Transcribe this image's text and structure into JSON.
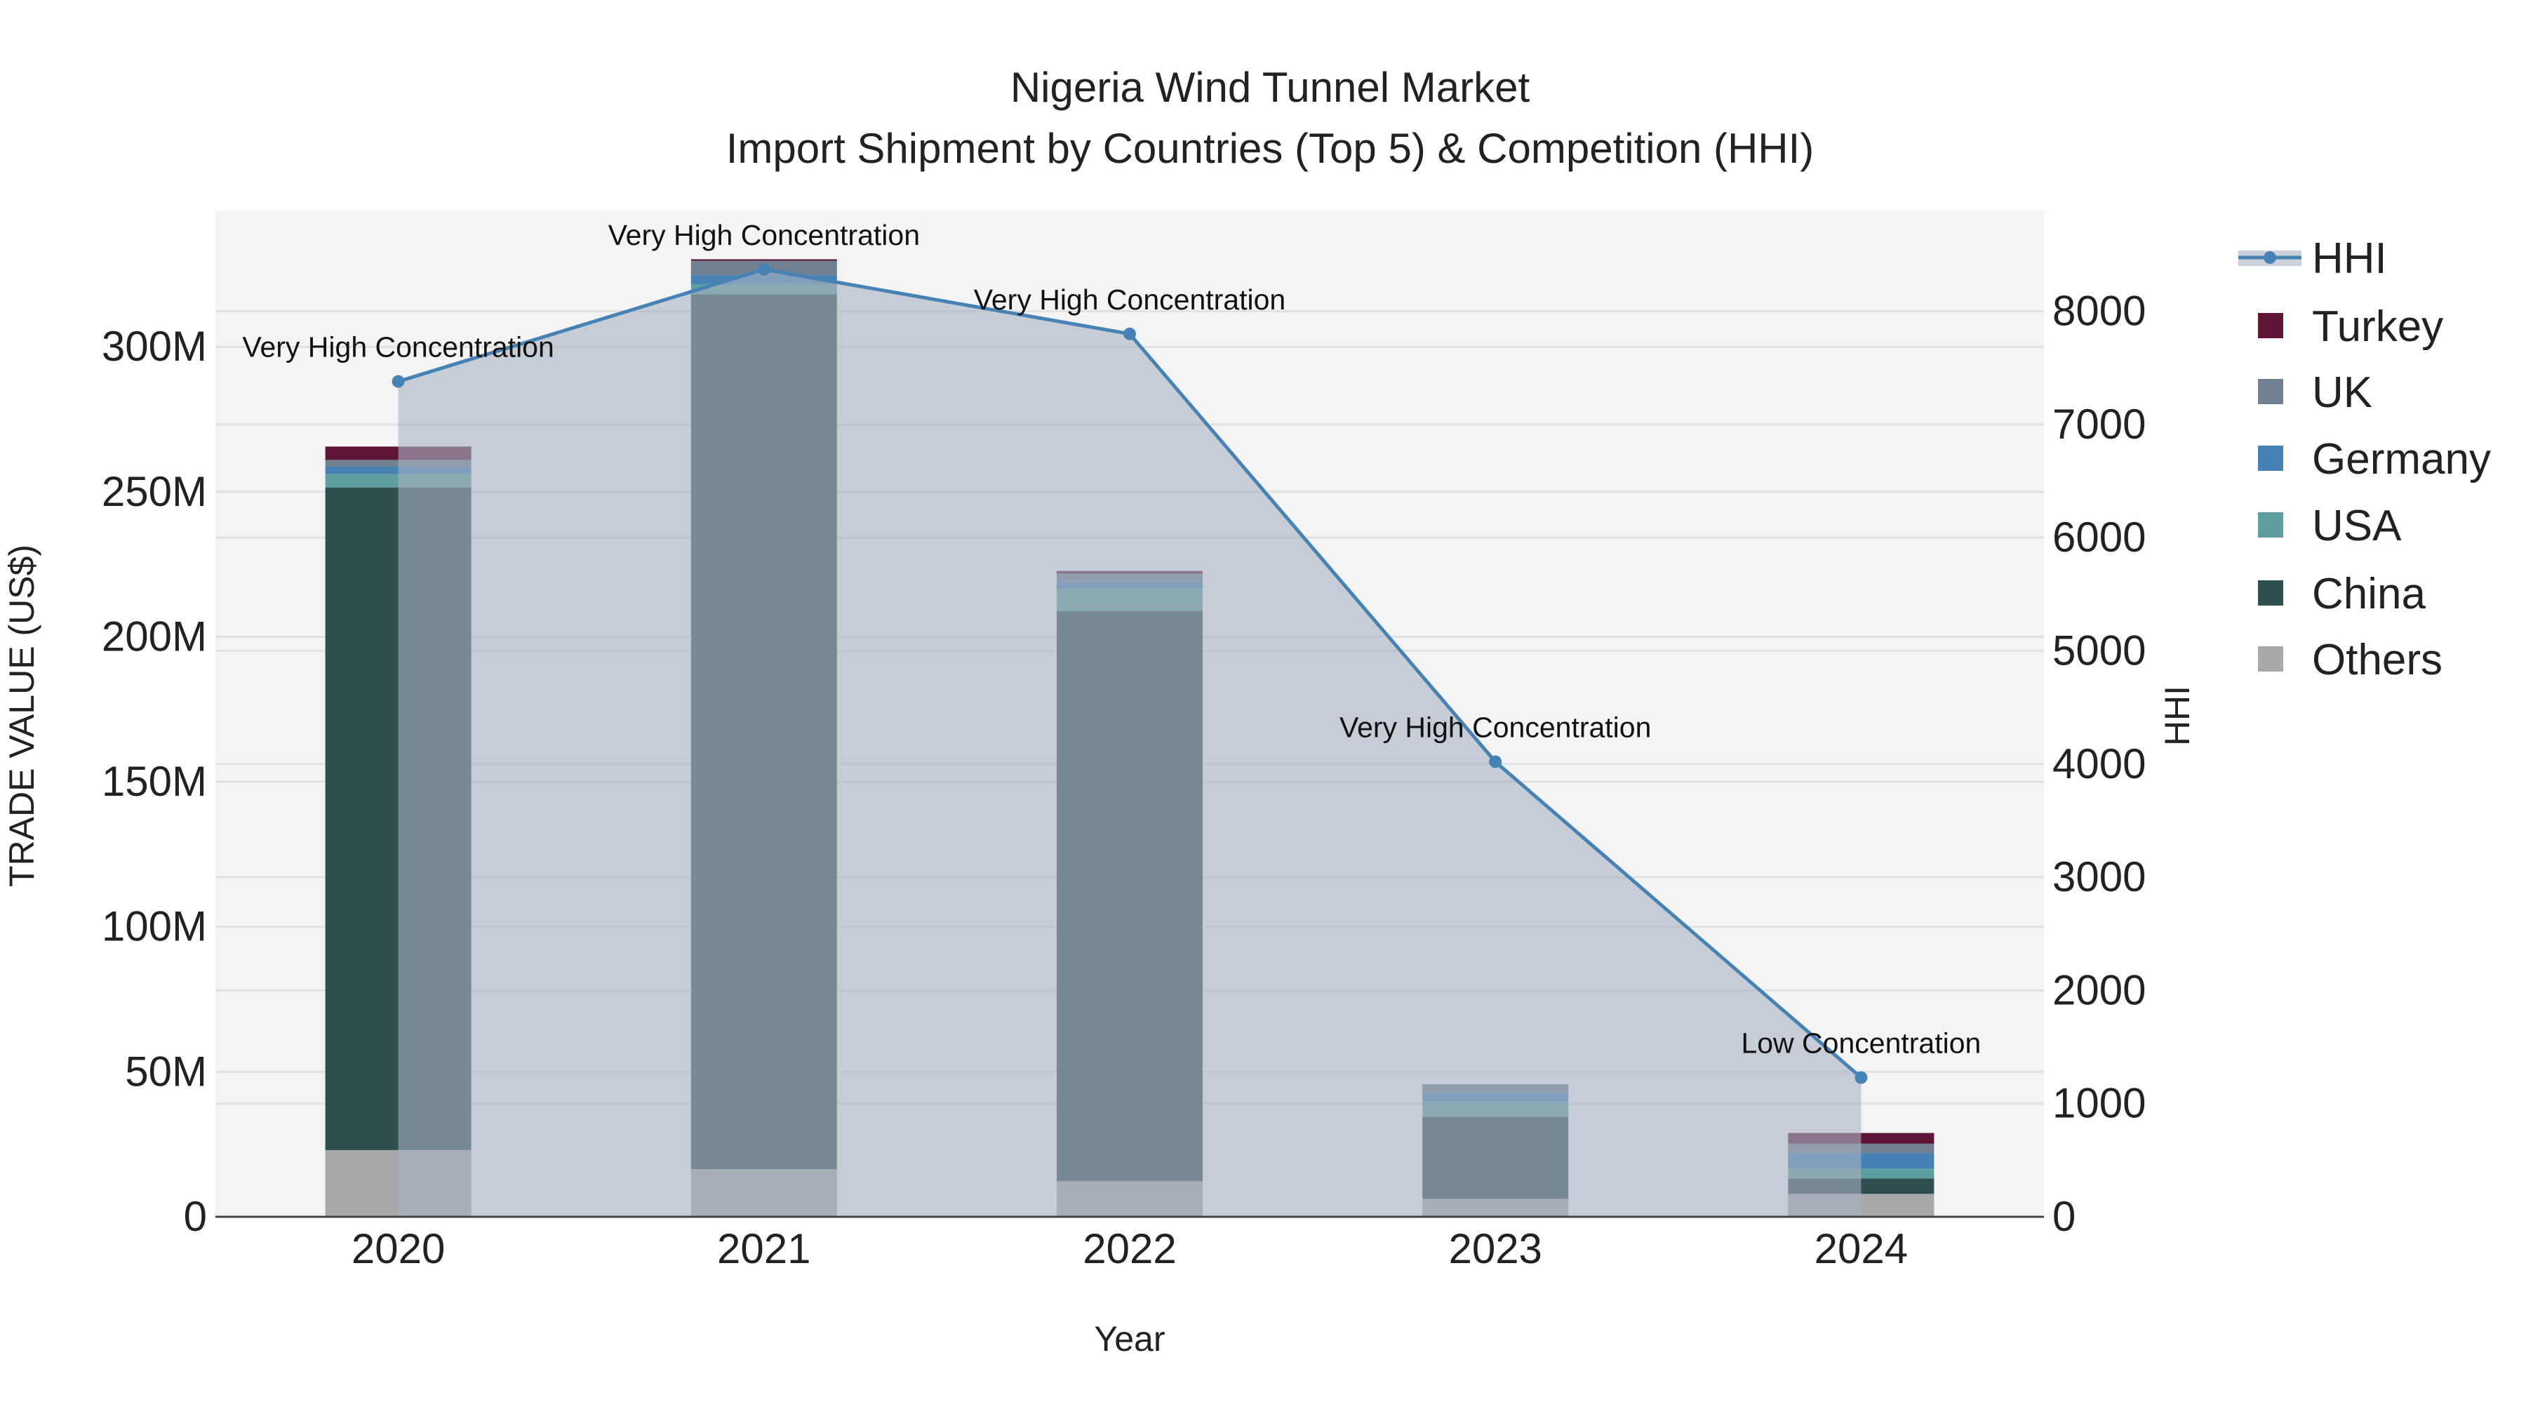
{
  "chart_data": {
    "type": "bar",
    "title": "Nigeria Wind Tunnel Market",
    "subtitle": "Import Shipment by Countries (Top 5) & Competition (HHI)",
    "xlabel": "Year",
    "ylabel": "TRADE VALUE (US$)",
    "y2label": "HHI",
    "categories": [
      "2020",
      "2021",
      "2022",
      "2023",
      "2024"
    ],
    "ylim": [
      0,
      347
    ],
    "y_unit": "M",
    "yticks": [
      0,
      50,
      100,
      150,
      200,
      250,
      300
    ],
    "ytick_labels": [
      "0",
      "50M",
      "100M",
      "150M",
      "200M",
      "250M",
      "300M"
    ],
    "y2lim": [
      0,
      8890
    ],
    "y2ticks": [
      0,
      1000,
      2000,
      3000,
      4000,
      5000,
      6000,
      7000,
      8000
    ],
    "y2tick_labels": [
      "0",
      "1000",
      "2000",
      "3000",
      "4000",
      "5000",
      "6000",
      "7000",
      "8000"
    ],
    "stacked": true,
    "series": [
      {
        "name": "Others",
        "color": "#a9a9a9",
        "values": [
          23.0,
          16.4,
          12.3,
          6.2,
          7.9
        ]
      },
      {
        "name": "China",
        "color": "#2f4f4f",
        "values": [
          228.5,
          301.7,
          196.6,
          28.3,
          5.3
        ]
      },
      {
        "name": "USA",
        "color": "#5f9ea0",
        "values": [
          4.6,
          3.5,
          7.7,
          5.3,
          3.4
        ]
      },
      {
        "name": "Germany",
        "color": "#4682b4",
        "values": [
          2.6,
          3.1,
          2.3,
          3.1,
          5.4
        ]
      },
      {
        "name": "UK",
        "color": "#708090",
        "values": [
          2.3,
          5.0,
          3.0,
          2.8,
          3.2
        ]
      },
      {
        "name": "Turkey",
        "color": "#5f1536",
        "values": [
          4.6,
          0.5,
          0.8,
          0.0,
          3.7
        ]
      }
    ],
    "hhi": {
      "name": "HHI",
      "color": "#4682b4",
      "values": [
        7380,
        8370,
        7800,
        4020,
        1230
      ],
      "annotations": [
        "Very High Concentration",
        "Very High Concentration",
        "Very High Concentration",
        "Very High Concentration",
        "Low Concentration"
      ]
    },
    "legend_order": [
      "HHI",
      "Turkey",
      "UK",
      "Germany",
      "USA",
      "China",
      "Others"
    ],
    "legend_placement": "right",
    "grid": true
  }
}
